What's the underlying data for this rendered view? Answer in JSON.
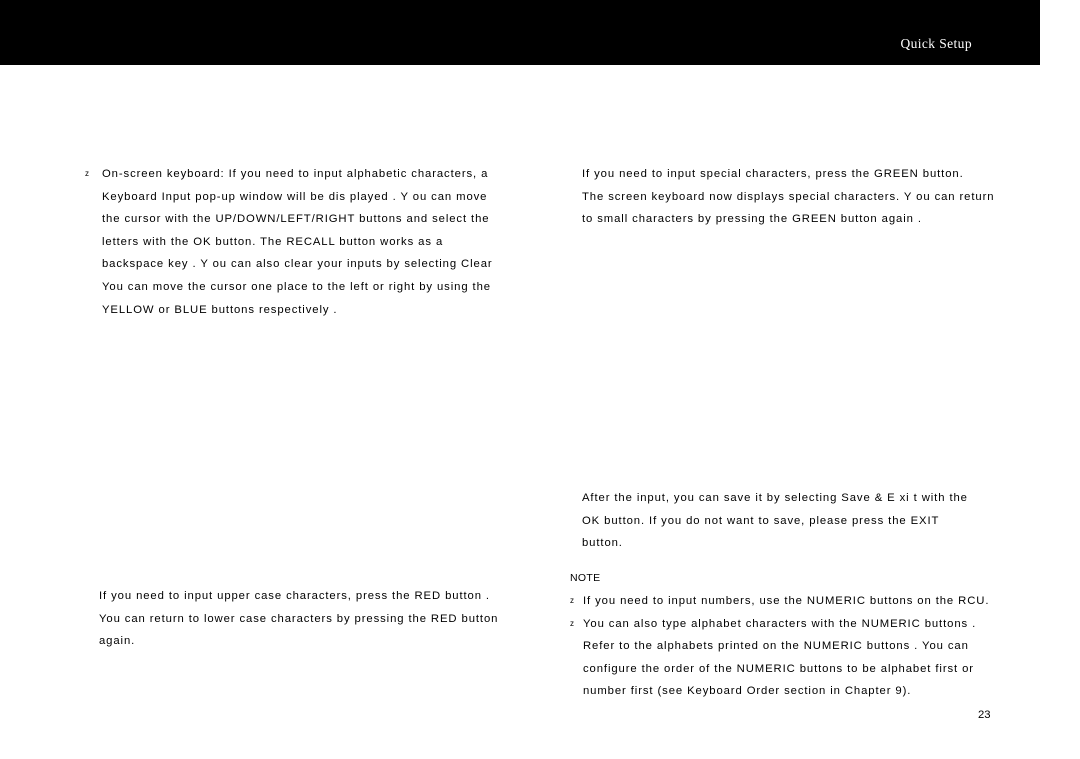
{
  "header": {
    "title": "Quick Setup"
  },
  "left_column": {
    "bullet_glyph": "z",
    "item1_lines": [
      "On-screen keyboard: If you need to input alphabetic characters, a",
      "Keyboard Input  pop-up window will  be dis            played .  Y ou can move",
      "the cursor with the            UP/DOWN/LEFT/RIGHT                buttons and select the",
      "letters  with  the          OK   button.             The  RECALL     button  works  as  a",
      "backspace key .  Y ou can also clear your inputs by selecting  Clear",
      "You can move the cursor one place to the left              or right by using the",
      "YELLOW   or  BLUE  buttons respectively        ."
    ]
  },
  "lower_left": {
    "lines": [
      "If  you need to input upper case characters, press the              RED  button .",
      "You can return to lower case characters by pressing the               RED  button",
      "again."
    ]
  },
  "right_column": {
    "item1_lines": [
      "If  you  need  to  input  special  characters,  press              the  GREEN   button.",
      "The screen keyboard now         displays  special characters.  Y  ou can return",
      "to small characters by pressing the            GREEN  button again  ."
    ]
  },
  "save_block": {
    "lines": [
      "After   the   input, you can save it by selecting                 Save &  E  xi t   with the",
      "OK   button.         If  you  do  not  want  to  save,  please  press  the                   EXIT",
      "button."
    ]
  },
  "note": {
    "title": "NOTE",
    "bullet_glyph": "z",
    "items": [
      {
        "lines": [
          "If you need to input numbers, use the          NUMERIC   buttons on the RCU."
        ]
      },
      {
        "lines": [
          "You can also type alphabet characters with  the             NUMERIC    buttons .",
          "Refer  to  the  alphabets  printed  on  the            NUMERIC    buttons  .   You  can",
          "configure  the order       of  the  NUMERIC   buttons   to be alphabet first or",
          "number first (see        Keyboard Order       section in Chapter 9)."
        ]
      }
    ]
  },
  "page_number": "23"
}
